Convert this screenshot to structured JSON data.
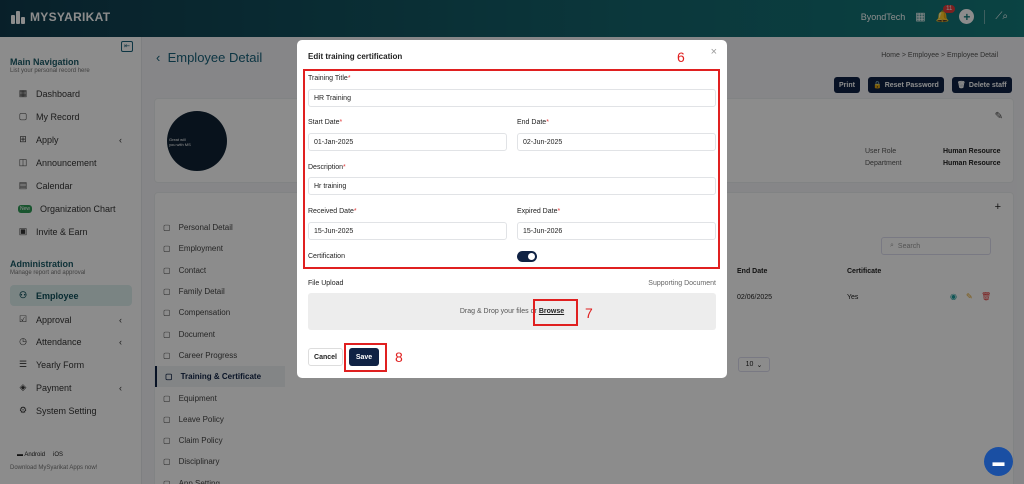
{
  "app": {
    "name": "MYSYARIKAT",
    "user": "ByondTech",
    "notif_count": "11"
  },
  "sidebar": {
    "main_nav": {
      "title": "Main Navigation",
      "sub": "List your personal record here"
    },
    "items": [
      {
        "label": "Dashboard",
        "icon": "dashboard-icon"
      },
      {
        "label": "My Record",
        "icon": "record-icon"
      },
      {
        "label": "Apply",
        "icon": "apply-icon"
      },
      {
        "label": "Announcement",
        "icon": "announcement-icon"
      },
      {
        "label": "Calendar",
        "icon": "calendar-icon"
      },
      {
        "label": "Organization Chart",
        "badge": "New"
      },
      {
        "label": "Invite & Earn",
        "icon": "invite-icon"
      }
    ],
    "admin": {
      "title": "Administration",
      "sub": "Manage report and approval"
    },
    "admin_items": [
      {
        "label": "Employee"
      },
      {
        "label": "Approval"
      },
      {
        "label": "Attendance"
      },
      {
        "label": "Yearly Form"
      },
      {
        "label": "Payment"
      },
      {
        "label": "System Setting"
      }
    ],
    "footer": {
      "android": "Android",
      "ios": "iOS",
      "download": "Download MySyarikat Apps now!"
    }
  },
  "page": {
    "title": "Employee Detail",
    "breadcrumb": [
      "Home",
      "Employee",
      "Employee Detail"
    ],
    "print": "Print",
    "reset_password": "Reset Password",
    "delete_staff": "Delete staff",
    "user_role_label": "User Role",
    "user_role": "Human Resource",
    "department_label": "Department",
    "department": "Human Resource",
    "tabs": [
      "Personal Detail",
      "Employment",
      "Contact",
      "Family Detail",
      "Compensation",
      "Document",
      "Career Progress",
      "Training & Certificate",
      "Equipment",
      "Leave Policy",
      "Claim Policy",
      "Disciplinary",
      "App Setting"
    ],
    "search_placeholder": "Search",
    "table_headers": [
      "End Date",
      "Certificate"
    ],
    "row": {
      "end_date": "02/06/2025",
      "certificate": "Yes"
    },
    "per_page": "10",
    "photo_caption": "Great will you with MS"
  },
  "modal": {
    "title": "Edit training certification",
    "training_title_label": "Training Title",
    "training_title": "HR Training",
    "start_date_label": "Start Date",
    "start_date": "01-Jan-2025",
    "end_date_label": "End Date",
    "end_date": "02-Jun-2025",
    "description_label": "Description",
    "description": "Hr training",
    "received_date_label": "Received Date",
    "received_date": "15-Jun-2025",
    "expired_date_label": "Expired Date",
    "expired_date": "15-Jun-2026",
    "certification_label": "Certification",
    "certification_on": true,
    "file_upload_label": "File Upload",
    "supporting_doc": "Supporting Document",
    "drop_text": "Drag & Drop your files or",
    "browse": "Browse",
    "cancel": "Cancel",
    "save": "Save"
  },
  "annotations": {
    "a6": "6",
    "a7": "7",
    "a8": "8",
    "color": "#e02020"
  }
}
